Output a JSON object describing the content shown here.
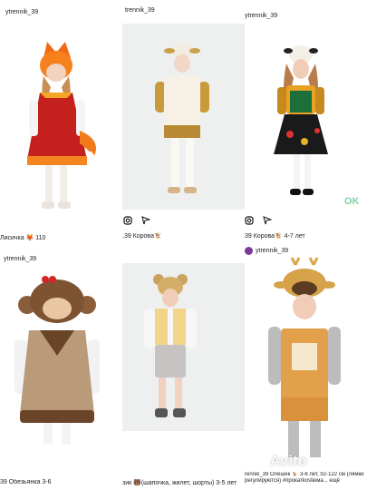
{
  "posts": [
    {
      "username": "ytrennik_39",
      "caption": "Лисичка 🦊 110"
    },
    {
      "username": "trennik_39",
      "caption": ",39 Корова🐮"
    },
    {
      "username": "ytrennik_39",
      "caption": "39 Корова🐮 4-7 лет",
      "username_bottom": "ytrennik_39"
    },
    {
      "username": "ytrennik_39",
      "caption": "39 Обезьянка 3-6"
    },
    {
      "caption": "зик 🐻(шапочка, жилет, шорты) 3-5 лет"
    },
    {
      "caption": "rennik_39 Олешек 🦌 3-6 лет, 92-122 см (лямки регулируются) #прокатkostюма... ещё"
    }
  ],
  "watermarks": {
    "ok": "OK",
    "avito": "Avito"
  },
  "colors": {
    "background": "#ffffff",
    "studio_grey": "#eef0f0"
  },
  "icons": [
    "instagram-icon",
    "send-icon"
  ]
}
